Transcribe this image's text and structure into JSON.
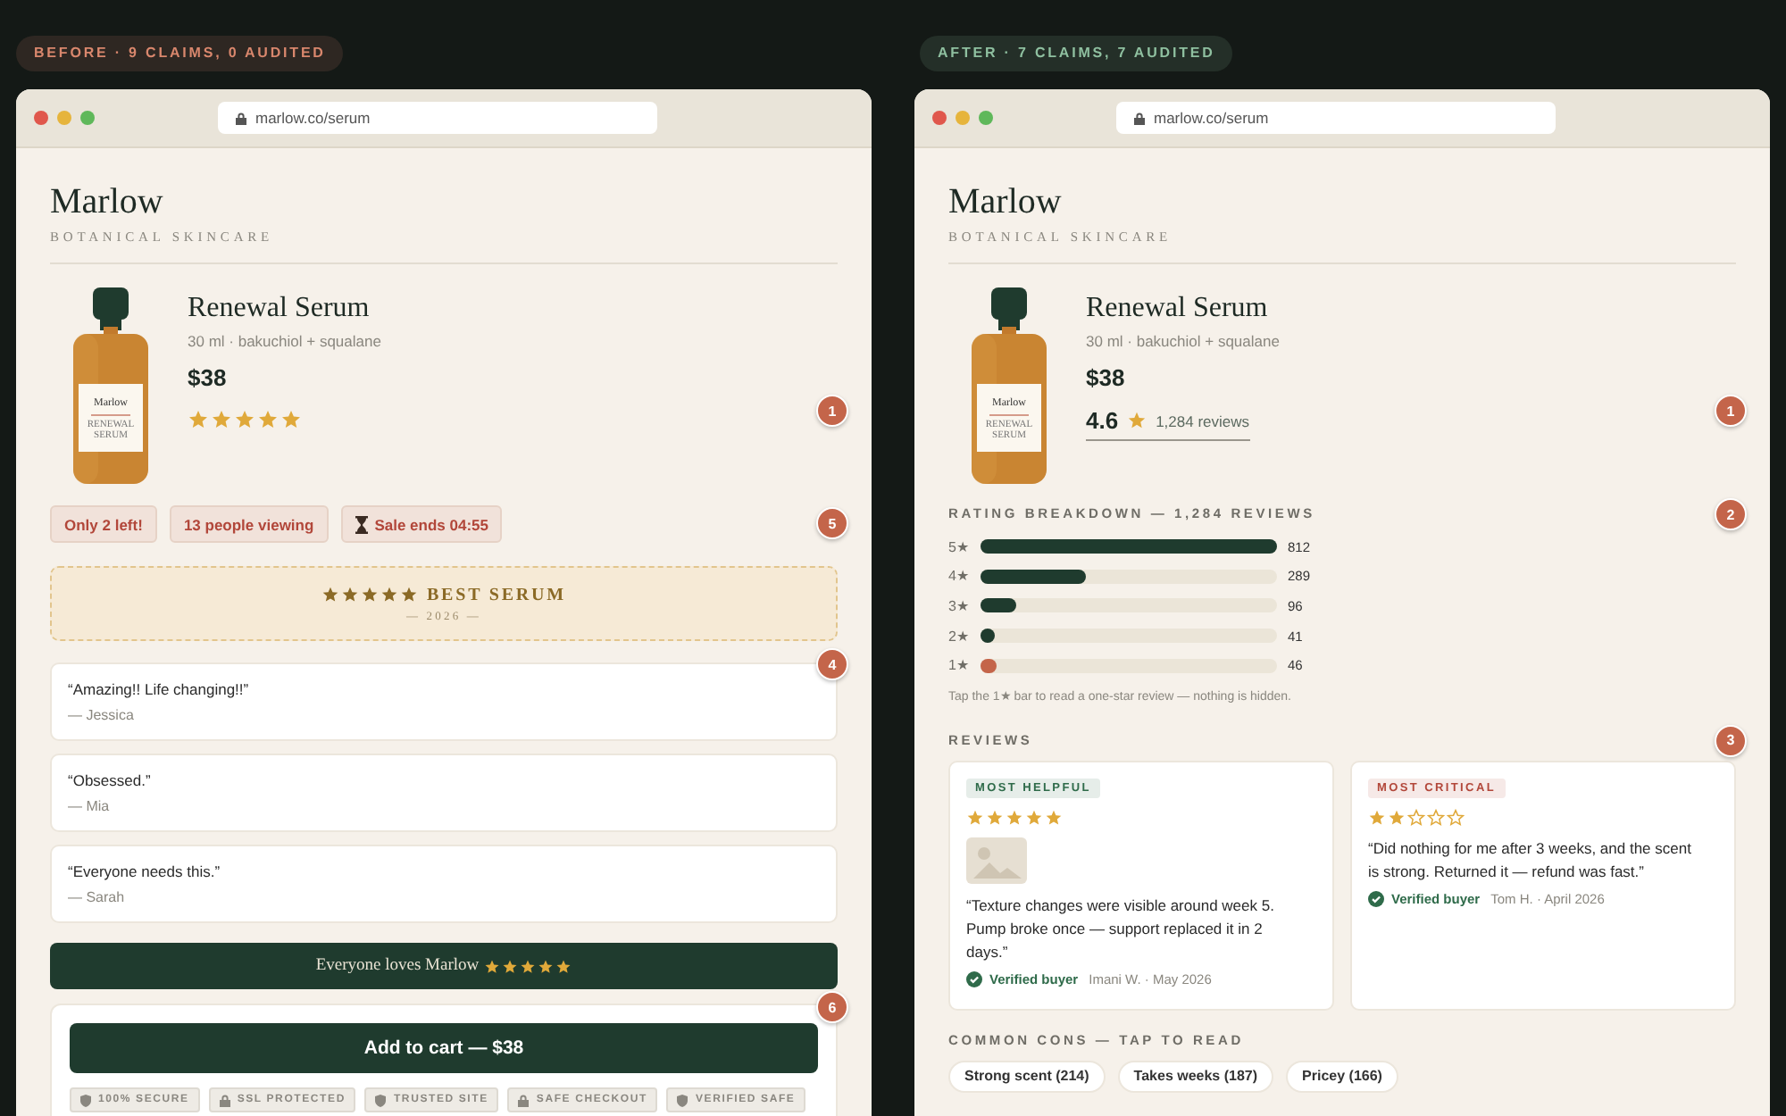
{
  "panels": [
    {
      "badge": "BEFORE · 9 CLAIMS, 0 AUDITED",
      "color": "#d9876d",
      "url": "marlow.co/serum",
      "brand": "Marlow",
      "tagline": "BOTANICAL SKINCARE",
      "sections": [
        {
          "kind": "product",
          "marker": "1",
          "label_brand": "Marlow",
          "label_text": "RENEWAL SERUM",
          "name": "Renewal Serum",
          "spec": "30 ml · bakuchiol + squalane",
          "price": "$38",
          "stars": 5
        },
        {
          "kind": "chips",
          "marker": "5",
          "chips": [
            {
              "text": "Only 2 left!",
              "timer": false
            },
            {
              "text": "13  people viewing",
              "timer": false
            },
            {
              "text": "Sale ends  04:55",
              "timer": true
            }
          ]
        },
        {
          "kind": "award",
          "stars": 5,
          "title": "BEST SERUM",
          "year": "— 2026 —"
        },
        {
          "kind": "testimonials",
          "marker": "4",
          "items": [
            {
              "quote": "“Amazing!! Life changing!!”",
              "author": "— Jessica"
            },
            {
              "quote": "“Obsessed.”",
              "author": "— Mia"
            },
            {
              "quote": "“Everyone needs this.”",
              "author": "— Sarah"
            }
          ]
        },
        {
          "kind": "banner",
          "text": "Everyone loves Marlow",
          "stars": 5
        },
        {
          "kind": "cart",
          "marker": "6",
          "button": "Add to cart — $38",
          "badges": [
            {
              "text": "100% SECURE",
              "kind": "shield"
            },
            {
              "text": "SSL PROTECTED",
              "kind": "lock"
            },
            {
              "text": "TRUSTED SITE",
              "kind": "shield"
            },
            {
              "text": "SAFE CHECKOUT",
              "kind": "lock"
            },
            {
              "text": "VERIFIED SAFE",
              "kind": "shield"
            }
          ]
        }
      ]
    },
    {
      "badge": "AFTER · 7 CLAIMS, 7 AUDITED",
      "color": "#8fc0a0",
      "url": "marlow.co/serum",
      "brand": "Marlow",
      "tagline": "BOTANICAL SKINCARE",
      "sections": [
        {
          "kind": "product",
          "marker": "1",
          "label_brand": "Marlow",
          "label_text": "RENEWAL SERUM",
          "name": "Renewal Serum",
          "spec": "30 ml · bakuchiol + squalane",
          "price": "$38",
          "rating": "4.6",
          "reviews": "1,284 reviews"
        },
        {
          "kind": "breakdown",
          "marker": "2",
          "title": "RATING BREAKDOWN — 1,284 REVIEWS",
          "rows": [
            {
              "label": "5★",
              "level": 1.0,
              "count": "812",
              "color": "#1f3b2e"
            },
            {
              "label": "4★",
              "level": 0.355,
              "count": "289",
              "color": "#1f3b2e"
            },
            {
              "label": "3★",
              "level": 0.118,
              "count": "96",
              "color": "#1f3b2e"
            },
            {
              "label": "2★",
              "level": 0.05,
              "count": "41",
              "color": "#1f3b2e"
            },
            {
              "label": "1★",
              "level": 0.057,
              "count": "46",
              "color": "#c4654a"
            }
          ],
          "note": "Tap the 1★ bar to read a one-star review — nothing is hidden."
        },
        {
          "kind": "reviews",
          "marker": "3",
          "title": "REVIEWS",
          "cards": [
            {
              "tag": "MOST HELPFUL",
              "color": "#2f6b4a",
              "stars": 5,
              "photo": true,
              "quote": "“Texture changes were visible around week 5. Pump broke once — support replaced it in 2 days.”",
              "verified": "Verified buyer",
              "meta": "Imani W. · May 2026"
            },
            {
              "tag": "MOST CRITICAL",
              "color": "#b2473a",
              "stars": 2,
              "photo": false,
              "quote": "“Did nothing for me after 3 weeks, and the scent is strong. Returned it — refund was fast.”",
              "verified": "Verified buyer",
              "meta": "Tom H. · April 2026"
            }
          ]
        },
        {
          "kind": "cons",
          "title": "COMMON CONS — TAP TO READ",
          "chips": [
            "Strong scent (214)",
            "Takes weeks (187)",
            "Pricey (166)"
          ]
        }
      ]
    }
  ]
}
